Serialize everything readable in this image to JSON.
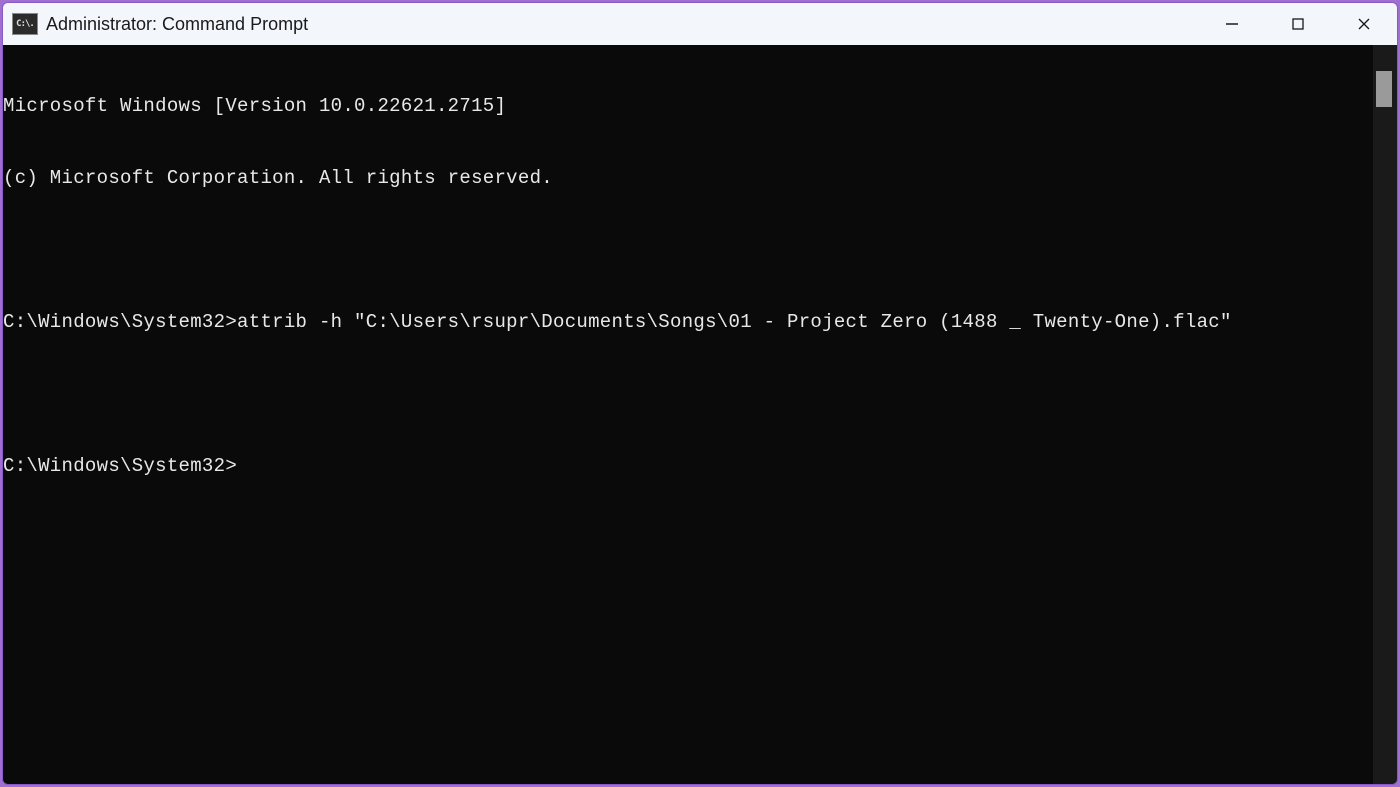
{
  "window": {
    "title": "Administrator: Command Prompt",
    "app_icon_text": "C:\\."
  },
  "terminal": {
    "lines": [
      "Microsoft Windows [Version 10.0.22621.2715]",
      "(c) Microsoft Corporation. All rights reserved.",
      "",
      "C:\\Windows\\System32>attrib -h \"C:\\Users\\rsupr\\Documents\\Songs\\01 - Project Zero (1488 _ Twenty-One).flac\"",
      "",
      "C:\\Windows\\System32>"
    ]
  }
}
